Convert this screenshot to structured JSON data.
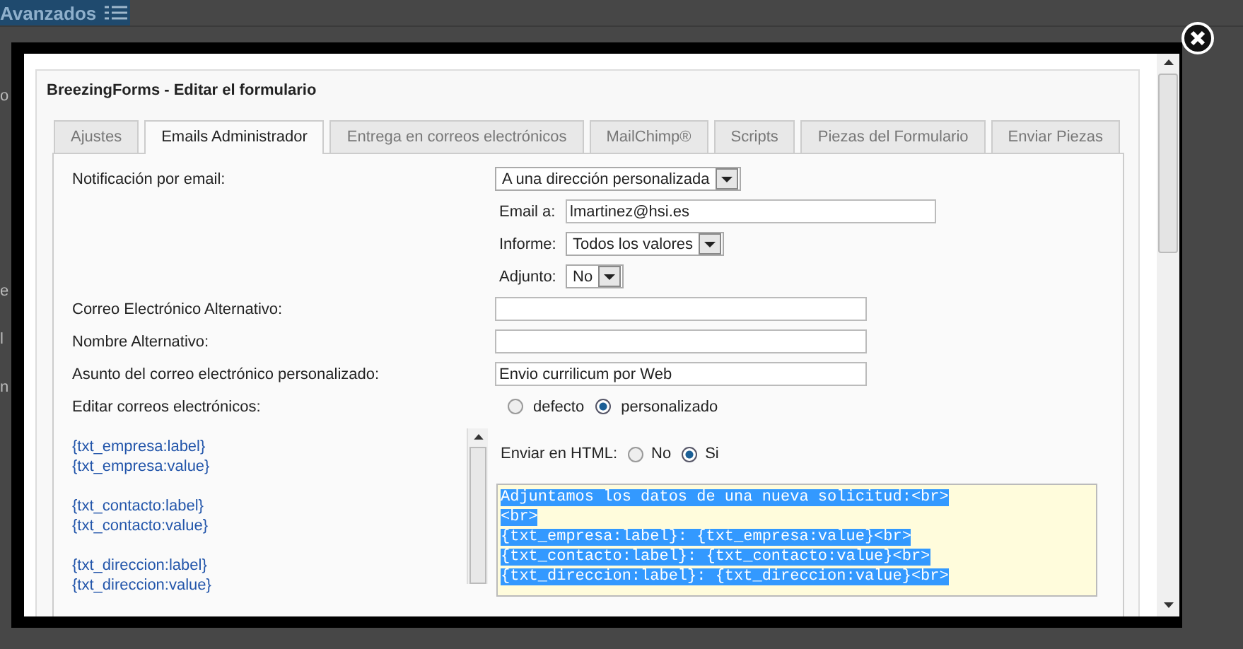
{
  "background": {
    "header_tab": "Avanzados",
    "fragments": [
      "o",
      "e",
      "l",
      "n"
    ]
  },
  "dialog": {
    "title": "BreezingForms - Editar el formulario",
    "tabs": [
      {
        "label": "Ajustes",
        "selected": false
      },
      {
        "label": "Emails Administrador",
        "selected": true
      },
      {
        "label": "Entrega en correos electrónicos",
        "selected": false
      },
      {
        "label": "MailChimp®",
        "selected": false
      },
      {
        "label": "Scripts",
        "selected": false
      },
      {
        "label": "Piezas del Formulario",
        "selected": false
      },
      {
        "label": "Enviar Piezas",
        "selected": false
      }
    ],
    "notification": {
      "label": "Notificación por email:",
      "value": "A una dirección personalizada"
    },
    "sub_fields": [
      {
        "label": "Email a:",
        "kind": "input",
        "value": "lmartinez@hsi.es"
      },
      {
        "label": "Informe:",
        "kind": "select",
        "value": "Todos los valores"
      },
      {
        "label": "Adjunto:",
        "kind": "select",
        "value": "No"
      }
    ],
    "text_fields": [
      {
        "label": "Correo Electrónico Alternativo:"
      },
      {
        "label": "Nombre Alternativo:"
      },
      {
        "label": "Asunto del correo electrónico personalizado:",
        "value": "Envio currilicum por Web"
      }
    ],
    "edit_emails": {
      "label": "Editar correos electrónicos:",
      "options": [
        {
          "label": "defecto",
          "selected": false
        },
        {
          "label": "personalizado",
          "selected": true
        }
      ]
    },
    "placeholders": [
      [
        "{txt_empresa:label}",
        "{txt_empresa:value}"
      ],
      [
        "{txt_contacto:label}",
        "{txt_contacto:value}"
      ],
      [
        "{txt_direccion:label}",
        "{txt_direccion:value}"
      ]
    ],
    "send_html": {
      "label": "Enviar en HTML:",
      "options": [
        {
          "label": "No",
          "selected": false
        },
        {
          "label": "Si",
          "selected": true
        }
      ]
    },
    "body_lines": [
      {
        "text": "Adjuntamos los datos de una nueva solicitud:<br>",
        "selected": true
      },
      {
        "text": "<br>",
        "selected": true
      },
      {
        "text": "{txt_empresa:label}: {txt_empresa:value}<br>",
        "selected": true
      },
      {
        "text": "{txt_contacto:label}: {txt_contacto:value}<br>",
        "selected": true
      },
      {
        "text": "{txt_direccion:label}: {txt_direccion:value}<br>",
        "selected": true
      }
    ]
  }
}
